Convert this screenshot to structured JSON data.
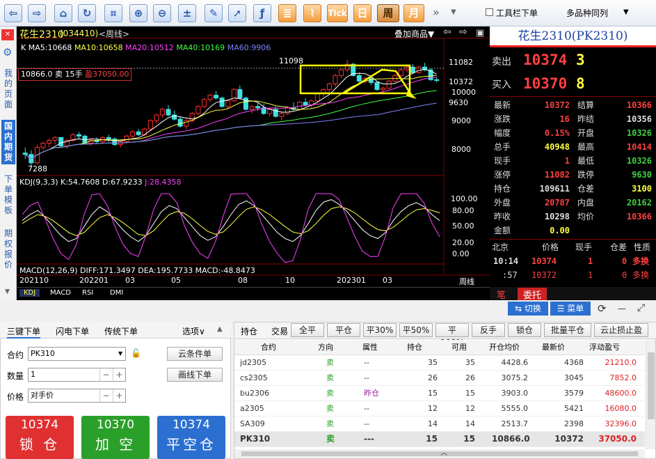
{
  "toolbar": {
    "buttons": [
      "back",
      "forward",
      "home",
      "refresh",
      "crop",
      "zoom-in",
      "zoom-out",
      "formula",
      "pencil",
      "select",
      "fx",
      "list",
      "chart",
      "Tick",
      "日",
      "周",
      "月"
    ],
    "toolbar_order": "工具栏下单",
    "multi_same": "多品种同列",
    "more": "»"
  },
  "leftnav": {
    "items": [
      "我的页面",
      "国内期货",
      "下单模板",
      "期权报价"
    ]
  },
  "chart": {
    "title": "花生2310",
    "code": "(034410)",
    "period": "<周线>",
    "overlay": "叠加商品▼",
    "ma_line": {
      "k": "K",
      "ma5": "MA5:10668",
      "ma10": "MA10:10658",
      "ma20": "MA20:10512",
      "ma40": "MA40:10169",
      "ma60": "MA60:9906"
    },
    "position_label": "10866.0 卖 15手",
    "position_profit": "盈37050.00",
    "high_mark": "11098",
    "low_mark": "7288",
    "price_labels": [
      "11082",
      "10372",
      "10000",
      "9630",
      "9000",
      "8000"
    ],
    "kdj_label": "KDJ(9,3,3) K:54.7608 D:67.9233",
    "kdj_j": "J:28.4358",
    "kdj_axis": [
      "100.00",
      "80.00",
      "50.00",
      "20.00",
      "0.00"
    ],
    "macd_label": "MACD(12,26,9) DIFF:171.3497 DEA:195.7733 MACD:-48.8473",
    "x_labels": [
      "202110",
      "202201",
      "03",
      "05",
      "08",
      "10",
      "202301",
      "03"
    ],
    "period_unit": "周线",
    "tabs": [
      "KDJ",
      "MACD",
      "RSI",
      "DMI"
    ],
    "candles": [
      [
        7800,
        8000,
        7600,
        7750
      ],
      [
        7750,
        7900,
        7288,
        7450
      ],
      [
        7450,
        8100,
        7400,
        8000
      ],
      [
        8000,
        8200,
        7900,
        8150
      ],
      [
        8150,
        8300,
        8000,
        8250
      ],
      [
        8250,
        8400,
        8100,
        8350
      ],
      [
        8350,
        8350,
        8000,
        8050
      ],
      [
        8050,
        8300,
        7950,
        8250
      ],
      [
        8250,
        8500,
        8200,
        8450
      ],
      [
        8450,
        8550,
        8300,
        8400
      ],
      [
        8400,
        8450,
        8100,
        8150
      ],
      [
        8150,
        8300,
        8050,
        8250
      ],
      [
        8250,
        8350,
        8150,
        8200
      ],
      [
        8200,
        8400,
        8150,
        8350
      ],
      [
        8350,
        8450,
        8200,
        8300
      ],
      [
        8300,
        8350,
        8050,
        8100
      ],
      [
        8100,
        8250,
        8000,
        8200
      ],
      [
        8200,
        8450,
        8150,
        8400
      ],
      [
        8400,
        8600,
        8350,
        8550
      ],
      [
        8550,
        8650,
        8400,
        8450
      ],
      [
        8450,
        8700,
        8400,
        8650
      ],
      [
        8650,
        9000,
        8600,
        8950
      ],
      [
        8950,
        9200,
        8850,
        9150
      ],
      [
        9150,
        9400,
        9050,
        9350
      ],
      [
        9350,
        9500,
        9100,
        9150
      ],
      [
        9150,
        9300,
        8950,
        9000
      ],
      [
        9000,
        9100,
        8700,
        8750
      ],
      [
        8750,
        9000,
        8650,
        8950
      ],
      [
        8950,
        9250,
        8900,
        9200
      ],
      [
        9200,
        9500,
        9150,
        9450
      ],
      [
        9450,
        9750,
        9400,
        9700
      ],
      [
        9700,
        9900,
        9600,
        9850
      ],
      [
        9850,
        10000,
        9700,
        9750
      ],
      [
        9750,
        9800,
        9400,
        9450
      ],
      [
        9450,
        9700,
        9350,
        9650
      ],
      [
        9650,
        10100,
        9600,
        10050
      ],
      [
        10050,
        10200,
        9700,
        9750
      ],
      [
        9750,
        9800,
        9300,
        9350
      ],
      [
        9350,
        9500,
        9200,
        9450
      ],
      [
        9450,
        9600,
        9300,
        9400
      ],
      [
        9400,
        9550,
        9150,
        9200
      ],
      [
        9200,
        9400,
        9100,
        9350
      ],
      [
        9350,
        9450,
        9050,
        9100
      ],
      [
        9100,
        9250,
        8950,
        9200
      ],
      [
        9200,
        9450,
        9150,
        9400
      ],
      [
        9400,
        9600,
        9300,
        9350
      ],
      [
        9350,
        9650,
        9300,
        9600
      ],
      [
        9600,
        9750,
        9450,
        9500
      ],
      [
        9500,
        9700,
        9400,
        9650
      ],
      [
        9650,
        9950,
        9600,
        9900
      ],
      [
        9900,
        10100,
        9800,
        10050
      ],
      [
        10050,
        10300,
        9950,
        10250
      ],
      [
        10250,
        10600,
        10150,
        10550
      ],
      [
        10550,
        10800,
        10450,
        10750
      ],
      [
        10750,
        11098,
        10650,
        10950
      ],
      [
        10950,
        11000,
        10500,
        10550
      ],
      [
        10550,
        10650,
        10300,
        10350
      ],
      [
        10350,
        10500,
        10250,
        10450
      ],
      [
        10450,
        10550,
        10200,
        10300
      ],
      [
        10300,
        10350,
        10000,
        10050
      ],
      [
        10050,
        10150,
        9900,
        10100
      ],
      [
        10100,
        10400,
        10050,
        10350
      ],
      [
        10350,
        10600,
        10300,
        10550
      ],
      [
        10550,
        10800,
        10500,
        10750
      ],
      [
        10750,
        10950,
        10650,
        10850
      ],
      [
        10850,
        10950,
        10600,
        10650
      ],
      [
        10650,
        10900,
        10600,
        10850
      ],
      [
        10850,
        11000,
        10700,
        10750
      ],
      [
        10750,
        10800,
        10350,
        10400
      ],
      [
        10400,
        10500,
        10300,
        10372
      ]
    ],
    "kdj": {
      "k": [
        55,
        65,
        72,
        60,
        45,
        30,
        20,
        25,
        45,
        65,
        78,
        70,
        55,
        40,
        28,
        20,
        30,
        50,
        70,
        80,
        75,
        60,
        45,
        30,
        22,
        28,
        45,
        65,
        82,
        88,
        80,
        65,
        50,
        35,
        25,
        20,
        30,
        50,
        72,
        86,
        90,
        82,
        70,
        55,
        40,
        30,
        25,
        35,
        55,
        70,
        80,
        85,
        78,
        65,
        55
      ],
      "d": [
        50,
        58,
        65,
        62,
        55,
        45,
        35,
        30,
        35,
        48,
        60,
        65,
        60,
        52,
        42,
        32,
        30,
        38,
        52,
        65,
        70,
        67,
        58,
        47,
        37,
        32,
        36,
        48,
        62,
        74,
        78,
        73,
        65,
        55,
        45,
        36,
        33,
        38,
        50,
        64,
        75,
        78,
        75,
        68,
        58,
        48,
        40,
        38,
        44,
        54,
        65,
        73,
        75,
        72,
        68
      ],
      "j": [
        65,
        80,
        86,
        57,
        25,
        0,
        -10,
        15,
        65,
        98,
        100,
        80,
        45,
        16,
        0,
        -5,
        30,
        74,
        100,
        100,
        85,
        46,
        19,
        0,
        -8,
        20,
        63,
        99,
        100,
        100,
        84,
        49,
        20,
        0,
        -15,
        -12,
        24,
        74,
        100,
        100,
        100,
        90,
        60,
        29,
        4,
        -5,
        -5,
        29,
        77,
        100,
        100,
        100,
        84,
        51,
        28
      ]
    }
  },
  "quote": {
    "title": "花生2310(PK2310)",
    "sell_label": "卖出",
    "sell_price": "10374",
    "sell_vol": "3",
    "buy_label": "买入",
    "buy_price": "10370",
    "buy_vol": "8",
    "rows": [
      [
        "最新",
        "10372",
        "结算",
        "10366"
      ],
      [
        "涨跌",
        "16",
        "昨结",
        "10356"
      ],
      [
        "幅度",
        "0.15%",
        "开盘",
        "10326"
      ],
      [
        "总手",
        "40948",
        "最高",
        "10414"
      ],
      [
        "现手",
        "1",
        "最低",
        "10326"
      ],
      [
        "涨停",
        "11082",
        "跌停",
        "9630"
      ],
      [
        "持仓",
        "109611",
        "仓差",
        "3100"
      ],
      [
        "外盘",
        "20787",
        "内盘",
        "20162"
      ],
      [
        "昨收",
        "10298",
        "均价",
        "10366"
      ],
      [
        "金额",
        "0.00",
        "",
        ""
      ]
    ],
    "tick_header": [
      "北京",
      "价格",
      "现手",
      "仓差",
      "性质"
    ],
    "ticks": [
      [
        "10:14",
        "10374",
        "1",
        "0",
        "多换"
      ],
      [
        ":57",
        "10372",
        "1",
        "0",
        "多换"
      ]
    ],
    "tabs": [
      "笔",
      "委托"
    ]
  },
  "panel_top": {
    "switch": "⇆ 切换",
    "menu": "☰ 菜单"
  },
  "order": {
    "tabs": [
      "三键下单",
      "闪电下单",
      "传统下单",
      "选项∨"
    ],
    "contract_label": "合约",
    "contract_value": "PK310",
    "cloud_cond": "云条件单",
    "qty_label": "数量",
    "qty_value": "1",
    "draw_order": "画线下单",
    "price_label": "价格",
    "price_value": "对手价",
    "buttons": [
      {
        "price": "10374",
        "label": "锁 仓",
        "color": "#e03030"
      },
      {
        "price": "10370",
        "label": "加 空",
        "color": "#2aa02a"
      },
      {
        "price": "10374",
        "label": "平空仓",
        "color": "#2b6fd0"
      }
    ]
  },
  "positions": {
    "tabs": [
      "持仓",
      "交易"
    ],
    "actions": [
      "全平",
      "平仓",
      "平30%",
      "平50%",
      "平100%",
      "反手",
      "锁仓",
      "批量平仓",
      "云止损止盈"
    ],
    "headers": [
      "合约",
      "方向",
      "属性",
      "持仓",
      "可用",
      "开仓均价",
      "最新价",
      "浮动盈亏"
    ],
    "rows": [
      [
        "jd2305",
        "卖",
        "--",
        "35",
        "35",
        "4428.6",
        "4368",
        "21210.0"
      ],
      [
        "cs2305",
        "卖",
        "--",
        "26",
        "26",
        "3075.2",
        "3045",
        "7852.0"
      ],
      [
        "bu2306",
        "卖",
        "昨仓",
        "15",
        "15",
        "3903.0",
        "3579",
        "48600.0"
      ],
      [
        "a2305",
        "卖",
        "--",
        "12",
        "12",
        "5555.0",
        "5421",
        "16080.0"
      ],
      [
        "SA309",
        "卖",
        "--",
        "14",
        "14",
        "2513.7",
        "2398",
        "32396.0"
      ],
      [
        "PK310",
        "卖",
        "---",
        "15",
        "15",
        "10866.0",
        "10372",
        "37050.0"
      ]
    ]
  }
}
